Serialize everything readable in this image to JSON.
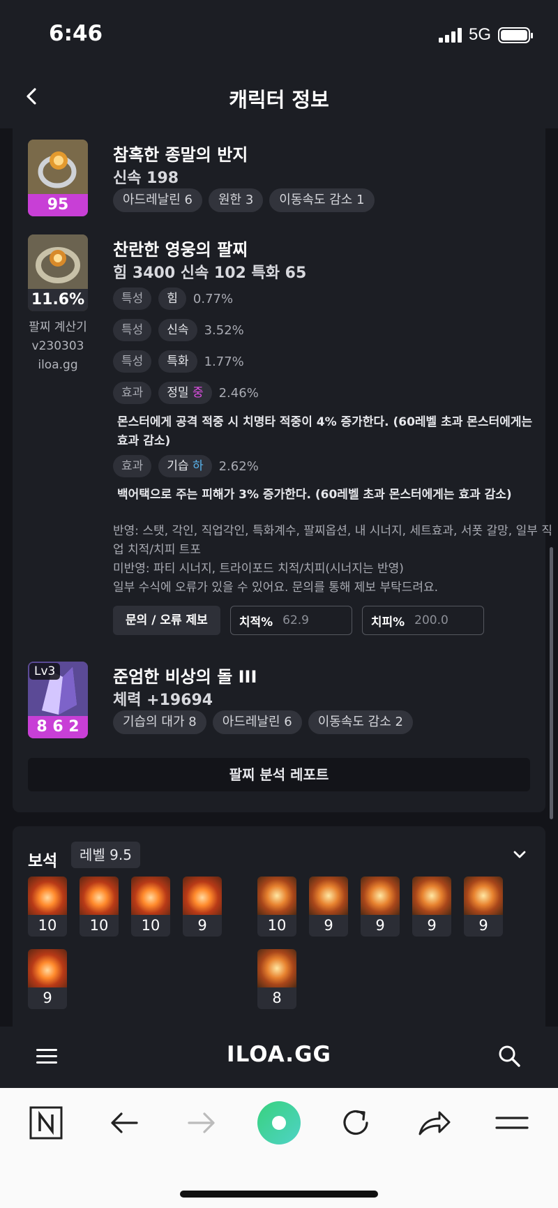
{
  "status": {
    "time": "6:46",
    "network": "5G"
  },
  "header": {
    "title": "캐릭터 정보"
  },
  "ring": {
    "name": "참혹한 종말의 반지",
    "quality": "95",
    "stat": "신속 198",
    "engravings": [
      "아드레날린 6",
      "원한 3",
      "이동속도 감소 1"
    ]
  },
  "bracelet": {
    "name": "찬란한 영웅의 팔찌",
    "percent": "11.6%",
    "stats": "힘 3400  신속 102  특화 65",
    "calculator": [
      "팔찌 계산기",
      "v230303",
      "iloa.gg"
    ],
    "props": [
      {
        "type": "특성",
        "name": "힘",
        "value": "0.77%"
      },
      {
        "type": "특성",
        "name": "신속",
        "value": "3.52%"
      },
      {
        "type": "특성",
        "name": "특화",
        "value": "1.77%"
      }
    ],
    "effects": [
      {
        "type": "효과",
        "name": "정밀",
        "grade": "중",
        "value": "2.46%",
        "desc": "몬스터에게 공격 적중 시 치명타 적중이 4% 증가한다. (60레벨 초과 몬스터에게는 효과 감소)"
      },
      {
        "type": "효과",
        "name": "기습",
        "grade": "하",
        "value": "2.62%",
        "desc": "백어택으로 주는 피해가 3% 증가한다. (60레벨 초과 몬스터에게는 효과 감소)"
      }
    ],
    "notes": [
      "반영: 스탯, 각인, 직업각인, 특화계수, 팔찌옵션, 내 시너지, 세트효과, 서폿 갈망, 일부 직업 치적/치피 트포",
      "미반영: 파티 시너지, 트라이포드 치적/치피(시너지는 반영)",
      "일부 수식에 오류가 있을 수 있어요. 문의를 통해 제보 부탁드려요."
    ],
    "report_button": "문의 / 오류 제보",
    "crit_rate": {
      "label": "치적%",
      "value": "62.9"
    },
    "crit_dmg": {
      "label": "치피%",
      "value": "200.0"
    }
  },
  "stone": {
    "name": "준엄한 비상의 돌 III",
    "level": "Lv3",
    "code": "8 6 2",
    "stat": "체력 +19694",
    "engravings": [
      "기습의 대가 8",
      "아드레날린 6",
      "이동속도 감소 2"
    ]
  },
  "analysis_button": "팔찌 분석 레포트",
  "gems": {
    "title": "보석",
    "level": "레벨 9.5",
    "left": [
      "10",
      "10",
      "10",
      "9",
      "9"
    ],
    "right": [
      "10",
      "9",
      "9",
      "9",
      "9",
      "8"
    ]
  },
  "nav": {
    "brand": "ILOA.GG"
  },
  "icons": {
    "back": "chevron-left-icon",
    "menu": "hamburger-icon",
    "search": "search-icon",
    "collapse": "chevron-down-icon"
  },
  "colors": {
    "accent": "#c83fd6",
    "grade_mid": "#e14fe6",
    "grade_low": "#59b4ee",
    "browser_green": "#3fd89a"
  }
}
